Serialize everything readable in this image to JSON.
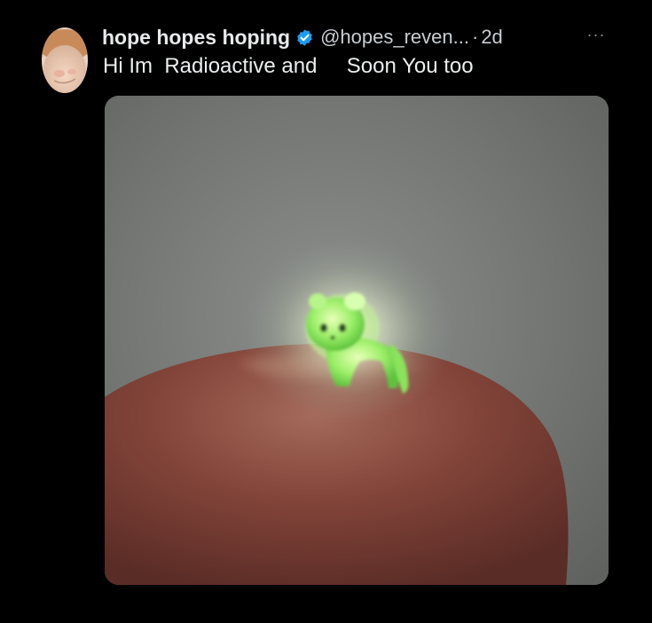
{
  "tweet": {
    "author": {
      "display_name": "hope hopes hoping",
      "verified_icon": "verified-badge-icon",
      "handle": "@hopes_reven...",
      "separator": "·",
      "time": "2d"
    },
    "more_icon": "more-horizontal-icon",
    "more_label": "···",
    "text": "Hi Im  Radioactive and     Soon You too",
    "media": {
      "subject": "glowing-green-figure-on-fingertip"
    }
  },
  "colors": {
    "background": "#000000",
    "text_primary": "#e7e9ea",
    "text_secondary": "#c9cdd1",
    "verified_blue": "#1d9bf0",
    "glow_green": "#9dff6a"
  }
}
